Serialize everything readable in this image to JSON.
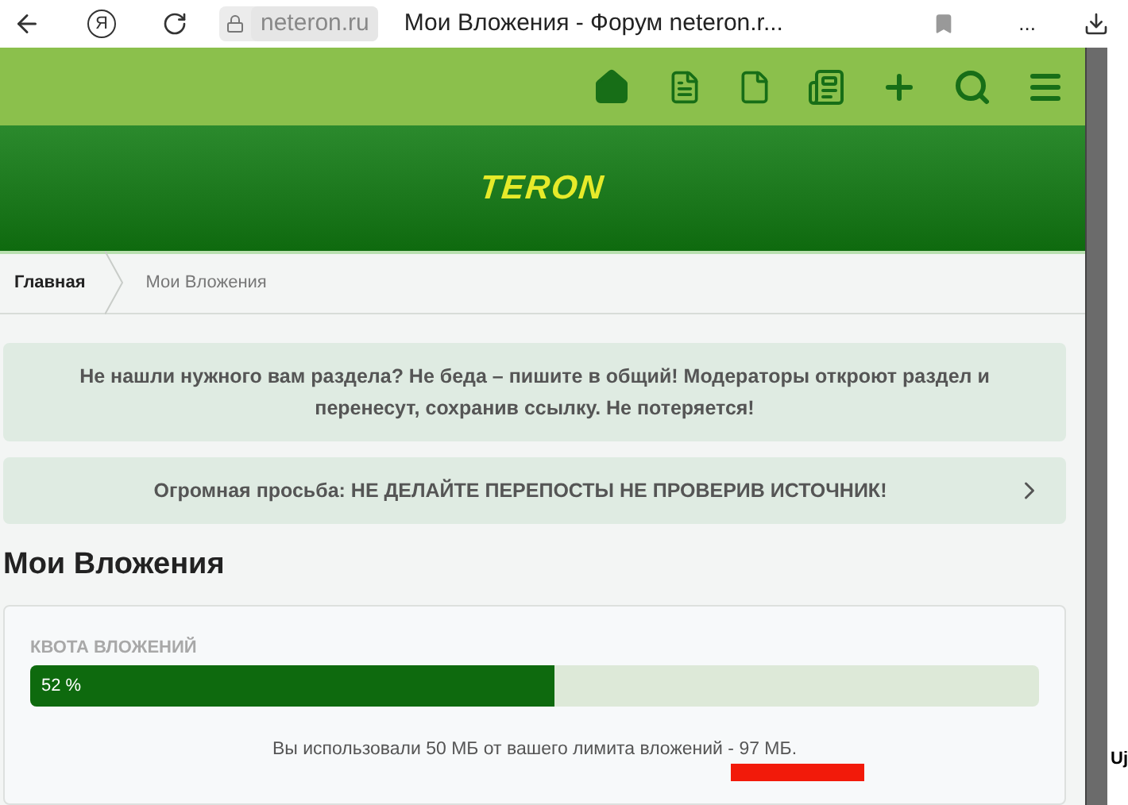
{
  "browser": {
    "logo": "Я",
    "address": "neteron.ru",
    "tab_title": "Мои Вложения - Форум neteron.r...",
    "menu": "..."
  },
  "logo": "TERON",
  "breadcrumbs": [
    {
      "label": "Главная",
      "current": false
    },
    {
      "label": "Мои Вложения",
      "current": true
    }
  ],
  "notices": [
    {
      "kind": "plain",
      "text": "Не нашли нужного вам раздела? Не беда – пишите в общий! Модераторы откроют раздел и перенесут, сохранив ссылку. Не потеряется!"
    },
    {
      "kind": "link",
      "text": "Огромная просьба: НЕ ДЕЛАЙТЕ ПЕРЕПОСТЫ НЕ ПРОВЕРИВ ИСТОЧНИК!"
    }
  ],
  "page_title": "Мои Вложения",
  "quota": {
    "label": "КВОТА ВЛОЖЕНИЙ",
    "level": 0.52,
    "reading": "52 %",
    "summary": "Вы использовали 50 МБ от вашего лимита вложений - 97 МБ."
  },
  "side_text": "Uj"
}
